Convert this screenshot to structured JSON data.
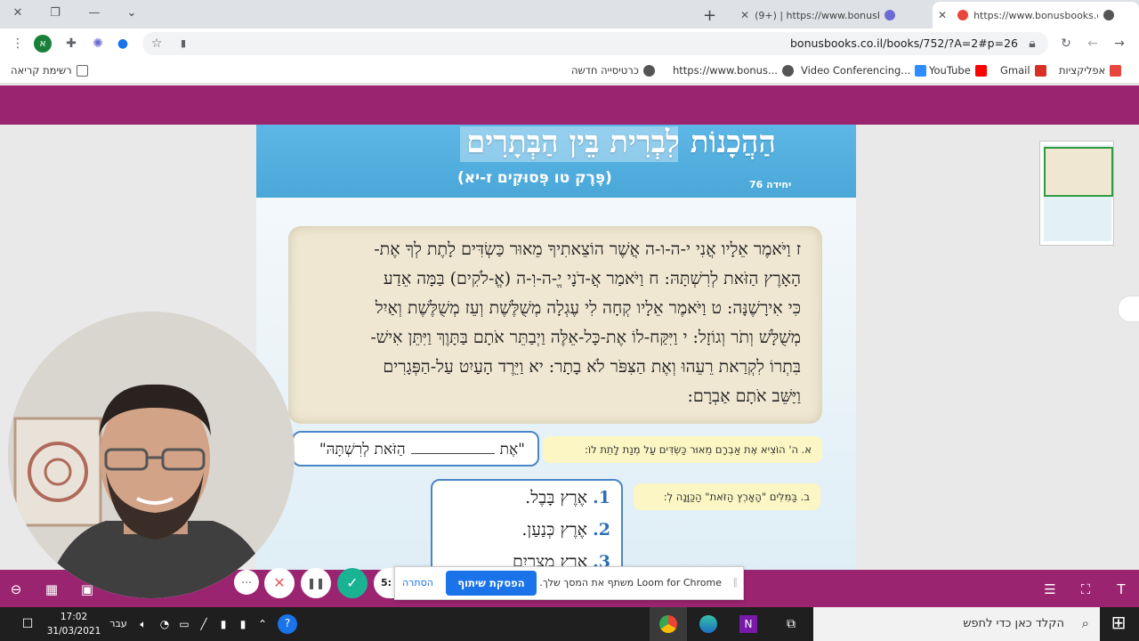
{
  "browser": {
    "tabs": [
      {
        "title": "https://www.bonusbooks.co.il",
        "active": true
      },
      {
        "title": "(9+) | https://www.bonusbooks.co",
        "active": false
      }
    ],
    "new_tab": "+",
    "url": "bonusbooks.co.il/books/752/?A=2#p=26",
    "profile_initial": "א",
    "reading_list": "רשימת קריאה",
    "bookmarks": [
      {
        "label": "אפליקציות",
        "icon_color": "#e8453c"
      },
      {
        "label": "Gmail",
        "icon_color": "#d93025"
      },
      {
        "label": "YouTube",
        "icon_color": "#ff0000"
      },
      {
        "label": "Video Conferencing...",
        "icon_color": "#2d8cff"
      },
      {
        "label": "https://www.bonus...",
        "icon_color": "#555555"
      },
      {
        "label": "כרטיסייה חדשה",
        "icon_color": "#555555"
      }
    ]
  },
  "book": {
    "title": "הַהֲכָנוֹת לִבְרִית בֵּין הַבְּתָרִים",
    "subtitle": "(פֶּרֶק טו פְּסוּקִים ז-יא)",
    "unit": "יחידה 76",
    "verse_lines": [
      "ז וַיֹּאמֶר אֵלָיו אֲנִי י-ה-ו-ה אֲשֶׁר הוֹצֵאתִיךָ מֵאוּר כַּשְׂדִּים לָתֶת לְךָ אֶת-",
      "הָאָרֶץ הַזֹּאת לְרִשְׁתָּהּ: ח וַיֹּאמַר אֲ-דֹנָי יֱ-ה-וִ-ה (אֱ-לֹקִים) בַּמָּה אֵדַע",
      "כִּי אִירָשֶׁנָּה: ט וַיֹּאמֶר אֵלָיו קְחָה לִי עֶגְלָה מְשֻׁלֶּשֶׁת וְעֵז מְשֻׁלֶּשֶׁת וְאַיִל",
      "מְשֻׁלָּשׁ וְתֹר וְגוֹזָל: י וַיִּקַּח-לוֹ אֶת-כָּל-אֵלֶּה וַיְבַתֵּר אֹתָם בַּתָּוֶךְ וַיִּתֵּן אִישׁ-",
      "בִּתְרוֹ לִקְרַאת רֵעֵהוּ וְאֶת הַצִּפֹּר לֹא בָתָר: יא וַיֵּרֶד הָעַיִט עַל-הַפְּגָרִים",
      "וַיַּשֵּׁב אֹתָם אַבְרָם:"
    ],
    "question_a": "א. ה' הוֹצִיא אֶת אַבְרָם מֵאוּר כַּשְׂדִּים עַל מְנַת לָתֵת לוֹ:",
    "answer_a_start": "\"אֶת",
    "answer_a_end": "הַזֹּאת לְרִשְׁתָּהּ\"",
    "question_b": "ב. בַּמִּלִּים \"הָאָרֶץ הַזֹּאת\" הַכַּוָּנָה לְ:",
    "options": [
      {
        "num": "1.",
        "text": "אֶרֶץ בָּבֶל."
      },
      {
        "num": "2.",
        "text": "אֶרֶץ כְּנַעַן."
      },
      {
        "num": "3.",
        "text": "אֶרֶץ מִצְרַיִם"
      }
    ]
  },
  "loom": {
    "timer": "5:",
    "share_text": "Loom for Chrome משתף את המסך שלך.",
    "stop_label": "הפסקת שיתוף",
    "hide_label": "הסתרה",
    "more": "⋯",
    "cancel": "✕",
    "pause": "❚❚",
    "done": "✓"
  },
  "taskbar": {
    "search_placeholder": "הקלד כאן כדי לחפש",
    "time": "17:02",
    "date": "31/03/2021",
    "language": "עבר"
  },
  "colors": {
    "brand_purple": "#9b2470",
    "book_blue": "#4aa7d8",
    "loom_blue": "#1a73e8",
    "loom_green": "#19b394"
  }
}
